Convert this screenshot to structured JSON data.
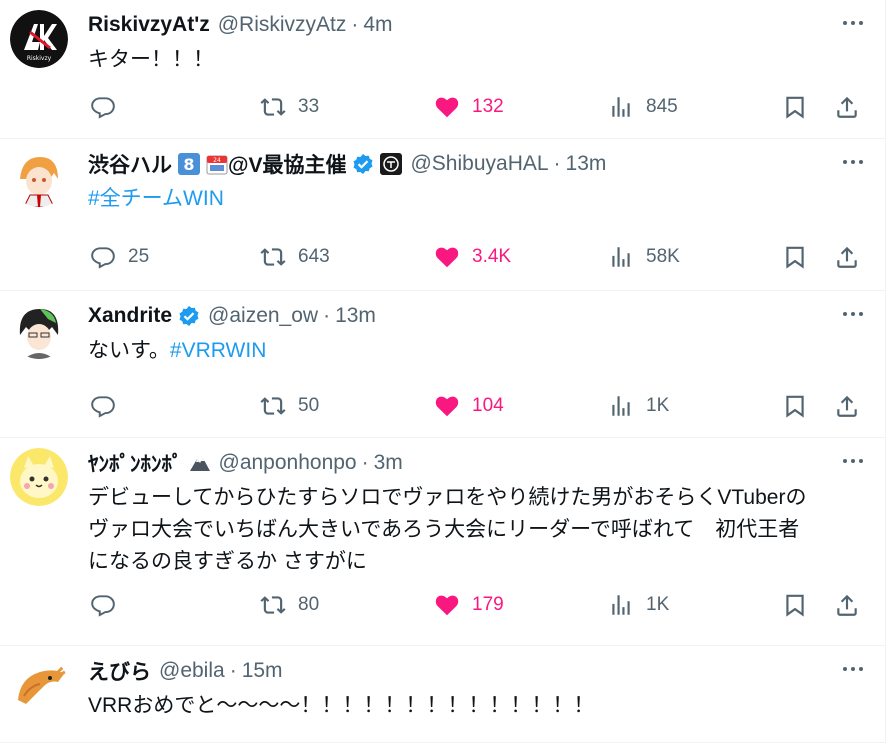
{
  "tweets": [
    {
      "name": "RiskivzyAt'z",
      "handle": "@RiskivzyAtz",
      "dot": "·",
      "time": "4m",
      "text": "キター！！！",
      "avatar_text": "Riskivzy",
      "replies": "",
      "retweets": "33",
      "likes": "132",
      "views": "845"
    },
    {
      "name": "渋谷ハル",
      "name_suffix": "@V最協主催",
      "badge_number": "8",
      "badge_calendar": "24",
      "handle": "@ShibuyaHAL",
      "dot": "·",
      "time": "13m",
      "text": "#全チームWIN",
      "replies": "25",
      "retweets": "643",
      "likes": "3.4K",
      "views": "58K"
    },
    {
      "name": "Xandrite",
      "handle": "@aizen_ow",
      "dot": "·",
      "time": "13m",
      "text_plain": "ないす。",
      "text_hashtag": "#VRRWIN",
      "replies": "",
      "retweets": "50",
      "likes": "104",
      "views": "1K"
    },
    {
      "name": "ﾔﾝﾎﾟﾝﾎﾝﾎﾟ",
      "handle": "@anponhonpo",
      "dot": "·",
      "time": "3m",
      "text": "デビューしてからひたすらソロでヴァロをやり続けた男がおそらくVTuberの\nヴァロ大会でいちばん大きいであろう大会にリーダーで呼ばれて　初代王者\nになるの良すぎるか さすがに",
      "replies": "",
      "retweets": "80",
      "likes": "179",
      "views": "1K"
    },
    {
      "name": "えびら",
      "handle": "@ebila",
      "dot": "·",
      "time": "15m",
      "text": "VRRおめでと〜〜〜〜！！！！！！！！！！！！！！"
    }
  ],
  "colors": {
    "text": "#0f1419",
    "secondary": "#536471",
    "like": "#f91880",
    "link": "#1d9bf0",
    "verified": "#1d9bf0"
  },
  "icons": [
    "reply-icon",
    "retweet-icon",
    "like-icon",
    "views-icon",
    "bookmark-icon",
    "share-icon",
    "more-icon",
    "verified-icon"
  ]
}
